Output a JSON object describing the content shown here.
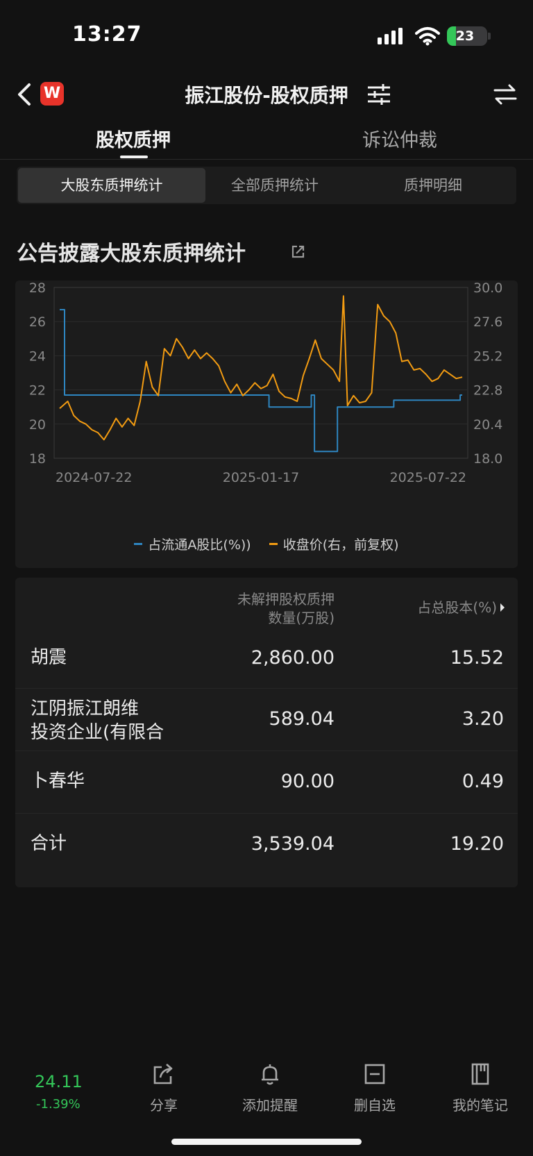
{
  "status_bar": {
    "time": "13:27",
    "battery": "23"
  },
  "nav": {
    "logo": "W",
    "title": "振江股份-股权质押"
  },
  "main_tabs": [
    {
      "label": "股权质押",
      "active": true
    },
    {
      "label": "诉讼仲裁",
      "active": false
    }
  ],
  "sub_tabs": [
    {
      "label": "大股东质押统计",
      "active": true
    },
    {
      "label": "全部质押统计",
      "active": false
    },
    {
      "label": "质押明细",
      "active": false
    }
  ],
  "section": {
    "title": "公告披露大股东质押统计"
  },
  "chart_data": {
    "type": "line",
    "x_tick_labels": [
      "2024-07-22",
      "2025-01-17",
      "2025-07-22"
    ],
    "y_left": {
      "ticks": [
        "28",
        "26",
        "24",
        "22",
        "20",
        "18"
      ],
      "range": [
        18,
        28
      ]
    },
    "y_right": {
      "ticks": [
        "30.0",
        "27.6",
        "25.2",
        "22.8",
        "20.4",
        "18.0"
      ],
      "range": [
        18.0,
        30.0
      ]
    },
    "grid": true,
    "legend_placement": "bottom-center",
    "series": [
      {
        "name": "占流通A股比(%))",
        "axis": "left",
        "color": "#2e86c1",
        "step": true,
        "points": [
          [
            0.0,
            26.7
          ],
          [
            0.012,
            26.7
          ],
          [
            0.012,
            21.7
          ],
          [
            0.52,
            21.7
          ],
          [
            0.52,
            21.0
          ],
          [
            0.625,
            21.0
          ],
          [
            0.625,
            21.7
          ],
          [
            0.633,
            21.7
          ],
          [
            0.633,
            18.4
          ],
          [
            0.69,
            18.4
          ],
          [
            0.69,
            21.0
          ],
          [
            0.83,
            21.0
          ],
          [
            0.83,
            21.4
          ],
          [
            0.995,
            21.4
          ],
          [
            0.995,
            21.7
          ],
          [
            1.0,
            21.7
          ]
        ]
      },
      {
        "name": "收盘价(右，前复权)",
        "axis": "right",
        "color": "#f39c12",
        "points": [
          [
            0.0,
            21.5
          ],
          [
            0.02,
            22.0
          ],
          [
            0.035,
            21.0
          ],
          [
            0.05,
            20.6
          ],
          [
            0.065,
            20.4
          ],
          [
            0.08,
            20.0
          ],
          [
            0.095,
            19.8
          ],
          [
            0.11,
            19.3
          ],
          [
            0.125,
            20.0
          ],
          [
            0.14,
            20.8
          ],
          [
            0.155,
            20.2
          ],
          [
            0.17,
            20.8
          ],
          [
            0.185,
            20.3
          ],
          [
            0.2,
            22.0
          ],
          [
            0.215,
            24.8
          ],
          [
            0.23,
            23.0
          ],
          [
            0.245,
            22.4
          ],
          [
            0.26,
            25.7
          ],
          [
            0.275,
            25.2
          ],
          [
            0.29,
            26.4
          ],
          [
            0.305,
            25.8
          ],
          [
            0.32,
            25.0
          ],
          [
            0.335,
            25.6
          ],
          [
            0.35,
            25.0
          ],
          [
            0.365,
            25.4
          ],
          [
            0.38,
            25.0
          ],
          [
            0.395,
            24.5
          ],
          [
            0.41,
            23.4
          ],
          [
            0.425,
            22.6
          ],
          [
            0.44,
            23.2
          ],
          [
            0.455,
            22.4
          ],
          [
            0.47,
            22.8
          ],
          [
            0.485,
            23.3
          ],
          [
            0.5,
            22.9
          ],
          [
            0.515,
            23.1
          ],
          [
            0.53,
            23.9
          ],
          [
            0.545,
            22.7
          ],
          [
            0.56,
            22.3
          ],
          [
            0.575,
            22.2
          ],
          [
            0.59,
            22.0
          ],
          [
            0.605,
            23.8
          ],
          [
            0.62,
            25.0
          ],
          [
            0.635,
            26.3
          ],
          [
            0.65,
            25.0
          ],
          [
            0.665,
            24.6
          ],
          [
            0.68,
            24.2
          ],
          [
            0.695,
            23.4
          ],
          [
            0.705,
            29.4
          ],
          [
            0.715,
            21.7
          ],
          [
            0.73,
            22.4
          ],
          [
            0.745,
            21.9
          ],
          [
            0.76,
            22.0
          ],
          [
            0.775,
            22.6
          ],
          [
            0.79,
            28.8
          ],
          [
            0.805,
            28.0
          ],
          [
            0.82,
            27.6
          ],
          [
            0.835,
            26.8
          ],
          [
            0.85,
            24.8
          ],
          [
            0.865,
            24.9
          ],
          [
            0.88,
            24.2
          ],
          [
            0.895,
            24.3
          ],
          [
            0.91,
            23.9
          ],
          [
            0.925,
            23.4
          ],
          [
            0.94,
            23.6
          ],
          [
            0.955,
            24.2
          ],
          [
            0.97,
            23.9
          ],
          [
            0.985,
            23.6
          ],
          [
            1.0,
            23.7
          ]
        ]
      }
    ]
  },
  "table": {
    "header_qty_line1": "未解押股权质押",
    "header_qty_line2": "数量(万股)",
    "header_pct": "占总股本(%)",
    "rows": [
      {
        "name": "胡震",
        "qty": "2,860.00",
        "pct": "15.52"
      },
      {
        "name_line1": "江阴振江朗维",
        "name_line2": "投资企业(有限合",
        "qty": "589.04",
        "pct": "3.20"
      },
      {
        "name": "卜春华",
        "qty": "90.00",
        "pct": "0.49"
      },
      {
        "name": "合计",
        "qty": "3,539.04",
        "pct": "19.20"
      }
    ]
  },
  "bottom_bar": {
    "price": "24.11",
    "change": "-1.39%",
    "items": [
      {
        "label": "分享",
        "icon": "share-icon"
      },
      {
        "label": "添加提醒",
        "icon": "bell-icon"
      },
      {
        "label": "删自选",
        "icon": "remove-watchlist-icon"
      },
      {
        "label": "我的笔记",
        "icon": "notebook-icon"
      }
    ]
  }
}
